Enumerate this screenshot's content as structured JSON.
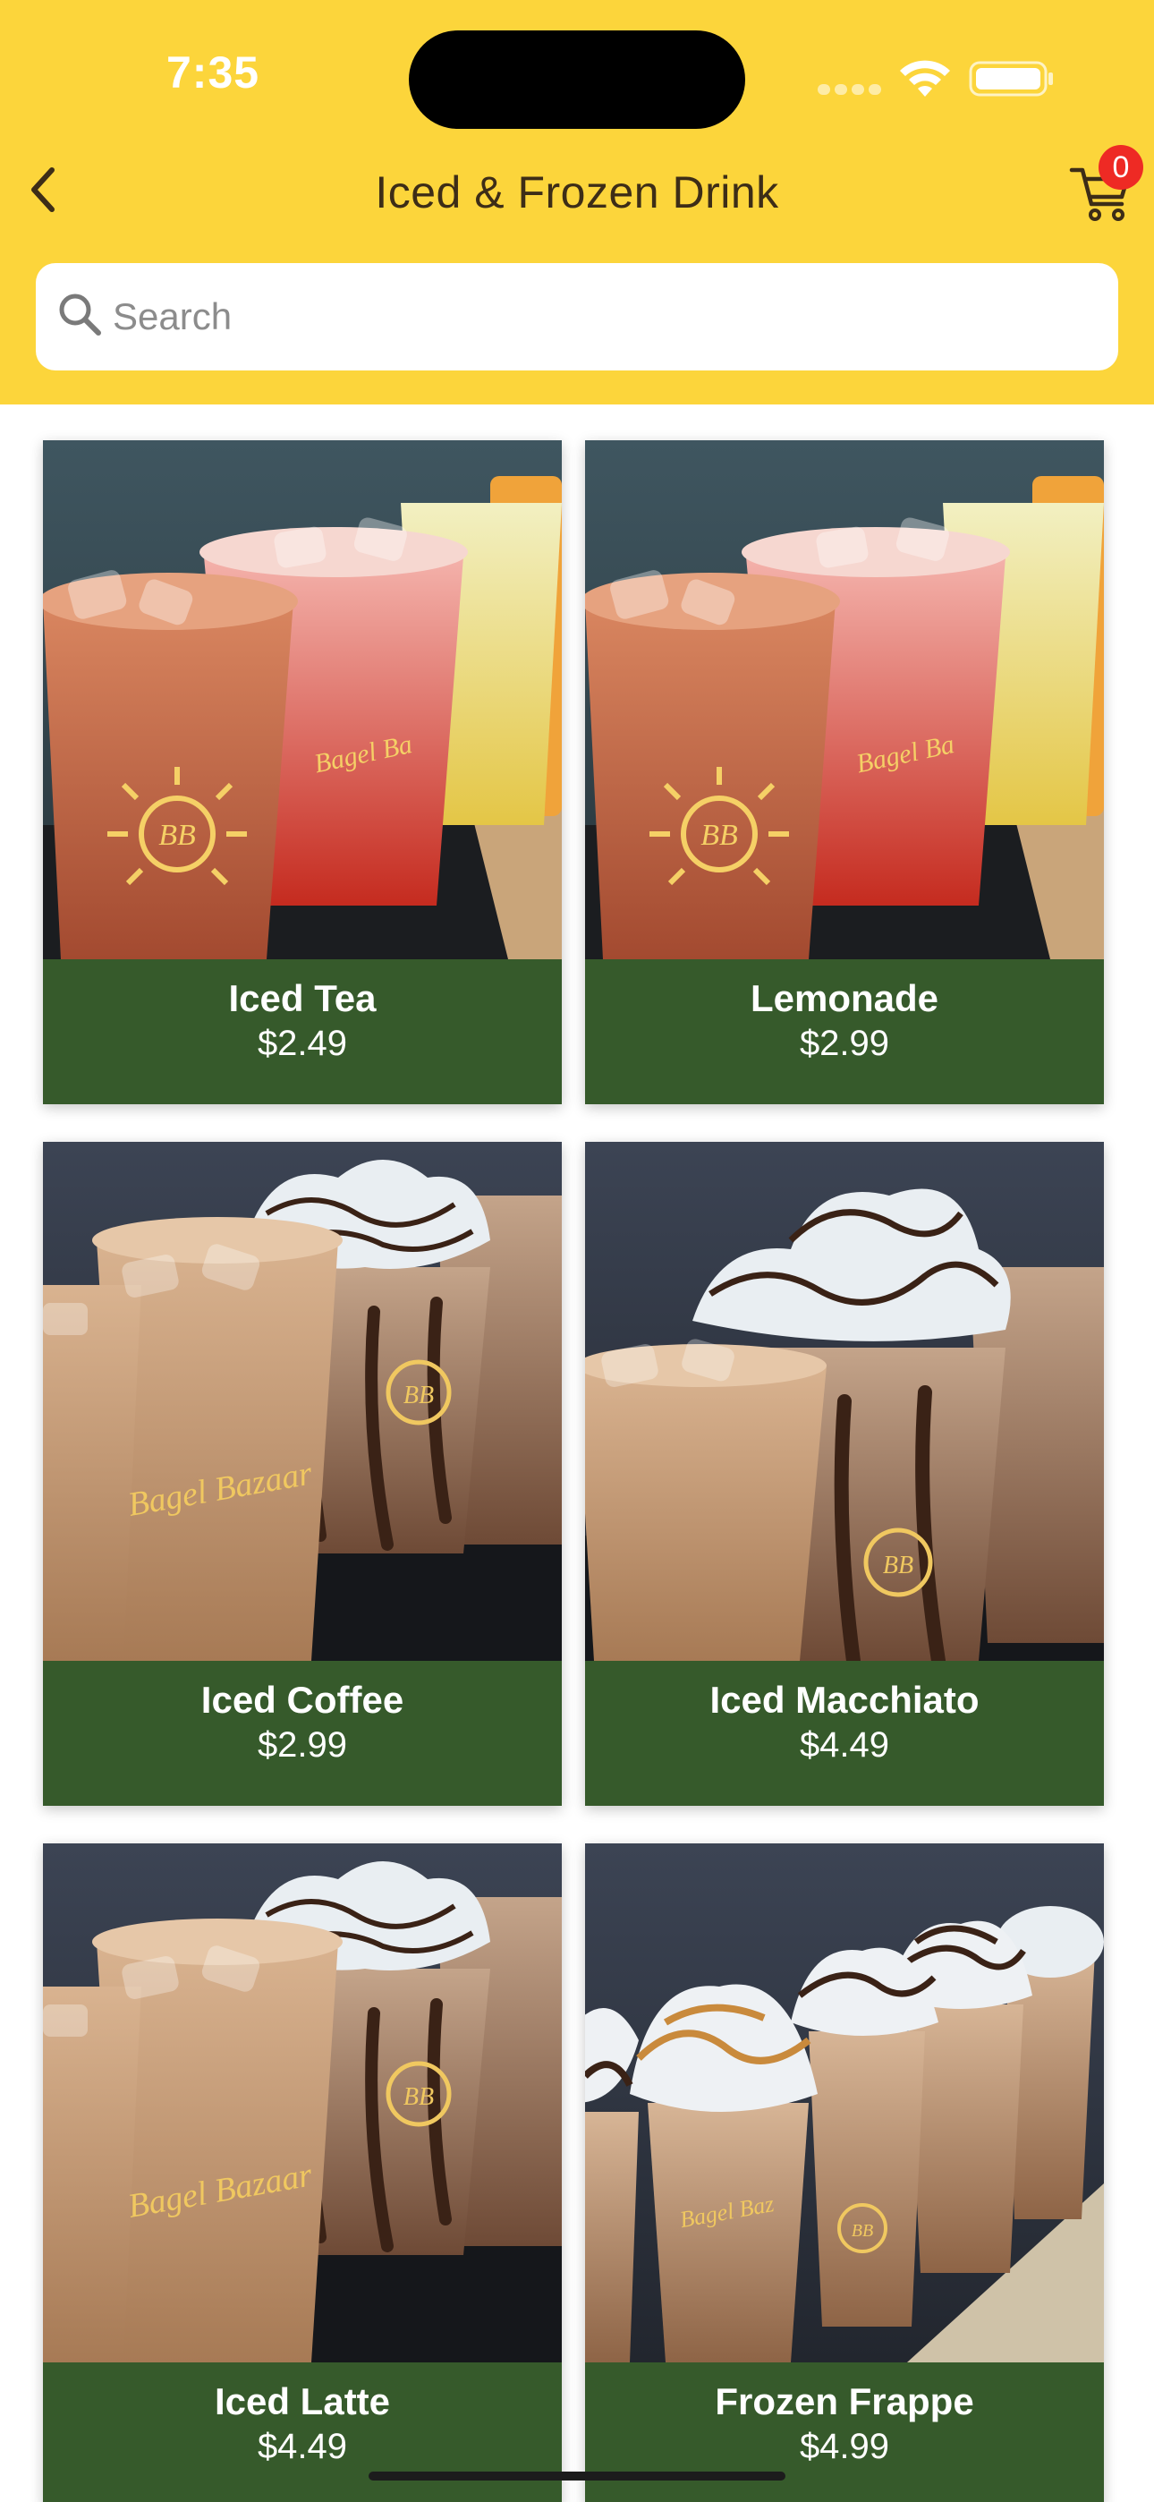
{
  "status_bar": {
    "time": "7:35"
  },
  "nav": {
    "title": "Iced & Frozen Drink",
    "cart_count": "0"
  },
  "search": {
    "placeholder": "Search",
    "value": ""
  },
  "products": [
    {
      "name": "Iced Tea",
      "price": "$2.49",
      "image": "iced-tea-photo"
    },
    {
      "name": "Lemonade",
      "price": "$2.99",
      "image": "lemonade-photo"
    },
    {
      "name": "Iced Coffee",
      "price": "$2.99",
      "image": "iced-coffee-photo"
    },
    {
      "name": "Iced Macchiato",
      "price": "$4.49",
      "image": "iced-macchiato-photo"
    },
    {
      "name": "Iced Latte",
      "price": "$4.49",
      "image": "iced-latte-photo"
    },
    {
      "name": "Frozen Frappe",
      "price": "$4.99",
      "image": "frozen-frappe-photo"
    }
  ],
  "colors": {
    "header_bg": "#fcd53b",
    "card_label_bg": "#365a2b",
    "badge": "#ee2a24",
    "title_text": "#3d2d17"
  }
}
